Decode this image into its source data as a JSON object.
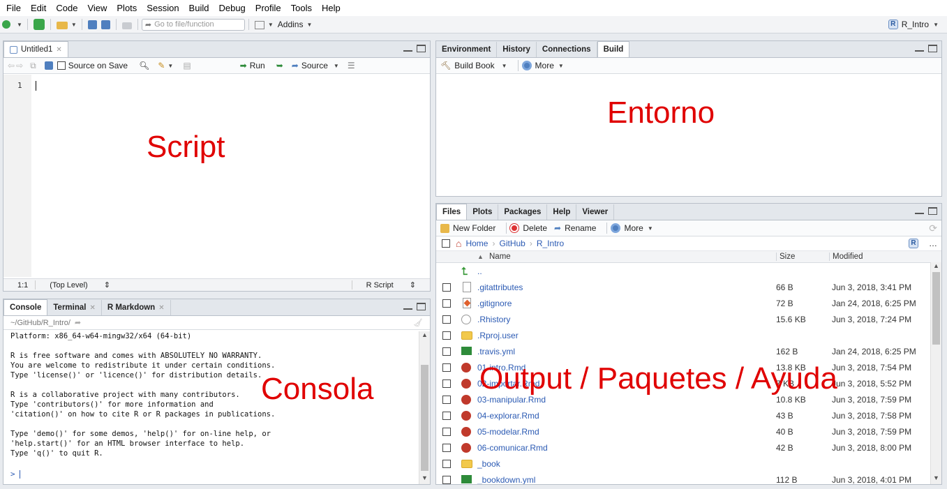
{
  "menu": [
    "File",
    "Edit",
    "Code",
    "View",
    "Plots",
    "Session",
    "Build",
    "Debug",
    "Profile",
    "Tools",
    "Help"
  ],
  "toolbar": {
    "goto_placeholder": "Go to file/function",
    "addins": "Addins",
    "project": "R_Intro"
  },
  "source": {
    "tab": "Untitled1",
    "source_on_save": "Source on Save",
    "run": "Run",
    "source_btn": "Source",
    "line_number": "1",
    "position": "1:1",
    "scope": "(Top Level)",
    "filetype": "R Script",
    "overlay": "Script"
  },
  "env": {
    "tabs": [
      "Environment",
      "History",
      "Connections",
      "Build"
    ],
    "active_tab": "Build",
    "build_book": "Build Book",
    "more": "More",
    "overlay": "Entorno"
  },
  "console": {
    "tabs": [
      "Console",
      "Terminal",
      "R Markdown"
    ],
    "path": "~/GitHub/R_Intro/",
    "text": "Platform: x86_64-w64-mingw32/x64 (64-bit)\n\nR is free software and comes with ABSOLUTELY NO WARRANTY.\nYou are welcome to redistribute it under certain conditions.\nType 'license()' or 'licence()' for distribution details.\n\nR is a collaborative project with many contributors.\nType 'contributors()' for more information and\n'citation()' on how to cite R or R packages in publications.\n\nType 'demo()' for some demos, 'help()' for on-line help, or\n'help.start()' for an HTML browser interface to help.\nType 'q()' to quit R.",
    "prompt": ">",
    "overlay": "Consola"
  },
  "files": {
    "tabs": [
      "Files",
      "Plots",
      "Packages",
      "Help",
      "Viewer"
    ],
    "active_tab": "Files",
    "new_folder": "New Folder",
    "delete": "Delete",
    "rename": "Rename",
    "more": "More",
    "breadcrumb": [
      "Home",
      "GitHub",
      "R_Intro"
    ],
    "columns": {
      "name": "Name",
      "size": "Size",
      "modified": "Modified"
    },
    "up": "..",
    "rows": [
      {
        "name": ".gitattributes",
        "icon": "file-icon",
        "size": "66 B",
        "modified": "Jun 3, 2018, 3:41 PM"
      },
      {
        "name": ".gitignore",
        "icon": "git-icon",
        "size": "72 B",
        "modified": "Jan 24, 2018, 6:25 PM"
      },
      {
        "name": ".Rhistory",
        "icon": "history-icon",
        "size": "15.6 KB",
        "modified": "Jun 3, 2018, 7:24 PM"
      },
      {
        "name": ".Rproj.user",
        "icon": "folder-icon",
        "size": "",
        "modified": ""
      },
      {
        "name": ".travis.yml",
        "icon": "yml-icon",
        "size": "162 B",
        "modified": "Jan 24, 2018, 6:25 PM"
      },
      {
        "name": "01-intro.Rmd",
        "icon": "rmd-icon",
        "size": "13.8 KB",
        "modified": "Jun 3, 2018, 7:54 PM"
      },
      {
        "name": "02-importar.Rmd",
        "icon": "rmd-icon",
        "size": "7 KB",
        "modified": "Jun 3, 2018, 5:52 PM"
      },
      {
        "name": "03-manipular.Rmd",
        "icon": "rmd-icon",
        "size": "10.8 KB",
        "modified": "Jun 3, 2018, 7:59 PM"
      },
      {
        "name": "04-explorar.Rmd",
        "icon": "rmd-icon",
        "size": "43 B",
        "modified": "Jun 3, 2018, 7:58 PM"
      },
      {
        "name": "05-modelar.Rmd",
        "icon": "rmd-icon",
        "size": "40 B",
        "modified": "Jun 3, 2018, 7:59 PM"
      },
      {
        "name": "06-comunicar.Rmd",
        "icon": "rmd-icon",
        "size": "42 B",
        "modified": "Jun 3, 2018, 8:00 PM"
      },
      {
        "name": "_book",
        "icon": "folder-icon",
        "size": "",
        "modified": ""
      },
      {
        "name": "_bookdown.yml",
        "icon": "yml-icon",
        "size": "112 B",
        "modified": "Jun 3, 2018, 4:01 PM"
      }
    ],
    "overlay": "Output / Paquetes / Ayuda"
  }
}
